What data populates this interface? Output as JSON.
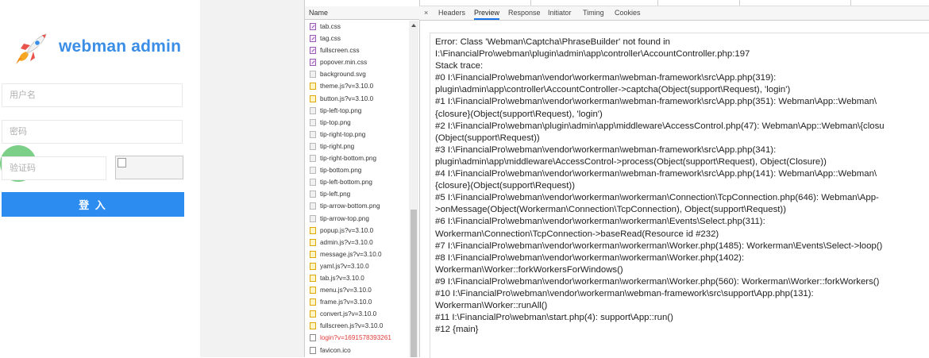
{
  "login": {
    "brand": "webman admin",
    "username_placeholder": "用户名",
    "password_placeholder": "密码",
    "captcha_placeholder": "验证码",
    "submit_label": "登 入",
    "accent_color": "#2d8cf0"
  },
  "devtools": {
    "name_header": "Name",
    "files": [
      {
        "name": "tab.css",
        "type": "css"
      },
      {
        "name": "tag.css",
        "type": "css"
      },
      {
        "name": "fullscreen.css",
        "type": "css"
      },
      {
        "name": "popover.min.css",
        "type": "css"
      },
      {
        "name": "background.svg",
        "type": "img"
      },
      {
        "name": "theme.js?v=3.10.0",
        "type": "js"
      },
      {
        "name": "button.js?v=3.10.0",
        "type": "js"
      },
      {
        "name": "tip-left-top.png",
        "type": "img"
      },
      {
        "name": "tip-top.png",
        "type": "img"
      },
      {
        "name": "tip-right-top.png",
        "type": "img"
      },
      {
        "name": "tip-right.png",
        "type": "img"
      },
      {
        "name": "tip-right-bottom.png",
        "type": "img"
      },
      {
        "name": "tip-bottom.png",
        "type": "img"
      },
      {
        "name": "tip-left-bottom.png",
        "type": "img"
      },
      {
        "name": "tip-left.png",
        "type": "img"
      },
      {
        "name": "tip-arrow-bottom.png",
        "type": "img"
      },
      {
        "name": "tip-arrow-top.png",
        "type": "img"
      },
      {
        "name": "popup.js?v=3.10.0",
        "type": "js"
      },
      {
        "name": "admin.js?v=3.10.0",
        "type": "js"
      },
      {
        "name": "message.js?v=3.10.0",
        "type": "js"
      },
      {
        "name": "yaml.js?v=3.10.0",
        "type": "js"
      },
      {
        "name": "tab.js?v=3.10.0",
        "type": "js"
      },
      {
        "name": "menu.js?v=3.10.0",
        "type": "js"
      },
      {
        "name": "frame.js?v=3.10.0",
        "type": "js"
      },
      {
        "name": "convert.js?v=3.10.0",
        "type": "js"
      },
      {
        "name": "fullscreen.js?v=3.10.0",
        "type": "js"
      },
      {
        "name": "login?v=1691578393261",
        "type": "err"
      },
      {
        "name": "favicon.ico",
        "type": "doc"
      }
    ],
    "tabs": [
      "Headers",
      "Preview",
      "Response",
      "Initiator",
      "Timing",
      "Cookies"
    ],
    "active_tab": "Preview",
    "close_glyph": "×",
    "error_color": "#e03b3b",
    "preview_lines": [
      "Error: Class 'Webman\\Captcha\\PhraseBuilder' not found in",
      "I:\\FinancialPro\\webman\\plugin\\admin\\app\\controller\\AccountController.php:197",
      "Stack trace:",
      "#0 I:\\FinancialPro\\webman\\vendor\\workerman\\webman-framework\\src\\App.php(319):",
      "plugin\\admin\\app\\controller\\AccountController->captcha(Object(support\\Request), 'login')",
      "#1 I:\\FinancialPro\\webman\\vendor\\workerman\\webman-framework\\src\\App.php(351): Webman\\App::Webman\\",
      "{closure}(Object(support\\Request), 'login')",
      "#2 I:\\FinancialPro\\webman\\plugin\\admin\\app\\middleware\\AccessControl.php(47): Webman\\App::Webman\\{closu",
      "(Object(support\\Request))",
      "#3 I:\\FinancialPro\\webman\\vendor\\workerman\\webman-framework\\src\\App.php(341):",
      "plugin\\admin\\app\\middleware\\AccessControl->process(Object(support\\Request), Object(Closure))",
      "#4 I:\\FinancialPro\\webman\\vendor\\workerman\\webman-framework\\src\\App.php(141): Webman\\App::Webman\\",
      "{closure}(Object(support\\Request))",
      "#5 I:\\FinancialPro\\webman\\vendor\\workerman\\workerman\\Connection\\TcpConnection.php(646): Webman\\App-",
      ">onMessage(Object(Workerman\\Connection\\TcpConnection), Object(support\\Request))",
      "#6 I:\\FinancialPro\\webman\\vendor\\workerman\\workerman\\Events\\Select.php(311):",
      "Workerman\\Connection\\TcpConnection->baseRead(Resource id #232)",
      "#7 I:\\FinancialPro\\webman\\vendor\\workerman\\workerman\\Worker.php(1485): Workerman\\Events\\Select->loop()",
      "#8 I:\\FinancialPro\\webman\\vendor\\workerman\\workerman\\Worker.php(1402):",
      "Workerman\\Worker::forkWorkersForWindows()",
      "#9 I:\\FinancialPro\\webman\\vendor\\workerman\\workerman\\Worker.php(560): Workerman\\Worker::forkWorkers()",
      "#10 I:\\FinancialPro\\webman\\vendor\\workerman\\webman-framework\\src\\support\\App.php(131):",
      "Workerman\\Worker::runAll()",
      "#11 I:\\FinancialPro\\webman\\start.php(4): support\\App::run()",
      "#12 {main}"
    ]
  }
}
